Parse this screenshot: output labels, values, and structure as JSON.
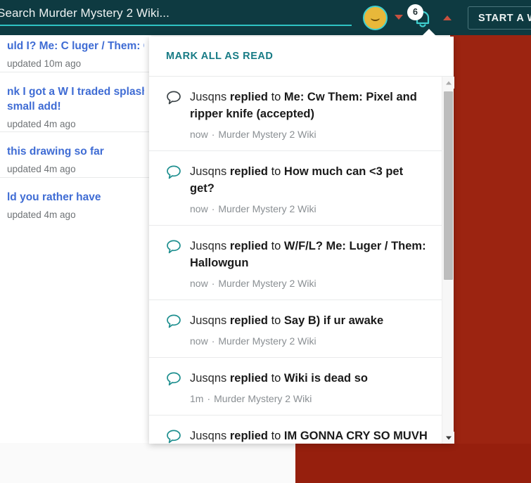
{
  "header": {
    "search_placeholder": "Search Murder Mystery 2 Wiki...",
    "search_value": "",
    "avatar_icon": "user-avatar-face",
    "avatar_face_glyph": "⌣",
    "user_caret_icon": "caret-down-icon",
    "bell_icon": "notification-bell-icon",
    "bell_badge_count": "6",
    "bell_caret_icon": "caret-up-icon",
    "start_wiki_label": "START A W",
    "colors": {
      "header_bg": "#0e3a41",
      "accent_teal": "#2ec3c3",
      "badge_red": "#c7513f",
      "content_red": "#9c2411"
    }
  },
  "sidebar": {
    "posts": [
      {
        "title": "uld I? Me: C luger / Them: C las",
        "meta": "updated 10m ago"
      },
      {
        "title": "nk I got a W I traded splash gu",
        "title2": "small add!",
        "meta": "updated 4m ago"
      },
      {
        "title": "this drawing so far",
        "meta": "updated 4m ago"
      },
      {
        "title": "ld you rather have",
        "meta": "updated 4m ago"
      }
    ]
  },
  "notifications_dropdown": {
    "mark_all_label": "MARK ALL AS READ",
    "scrollbar": {
      "up_icon": "scroll-up-arrow-icon",
      "down_icon": "scroll-down-arrow-icon"
    },
    "items": [
      {
        "icon": "comment-bubble-icon",
        "read": true,
        "actor": "Jusqns",
        "verb": "replied",
        "prep": "to",
        "subject": "Me: Cw Them: Pixel and ripper knife (accepted)",
        "time": "now",
        "wiki": "Murder Mystery 2 Wiki"
      },
      {
        "icon": "comment-bubble-icon",
        "read": false,
        "actor": "Jusqns",
        "verb": "replied",
        "prep": "to",
        "subject": "How much can <3 pet get?",
        "time": "now",
        "wiki": "Murder Mystery 2 Wiki"
      },
      {
        "icon": "comment-bubble-icon",
        "read": false,
        "actor": "Jusqns",
        "verb": "replied",
        "prep": "to",
        "subject": "W/F/L? Me: Luger / Them: Hallowgun",
        "time": "now",
        "wiki": "Murder Mystery 2 Wiki"
      },
      {
        "icon": "comment-bubble-icon",
        "read": false,
        "actor": "Jusqns",
        "verb": "replied",
        "prep": "to",
        "subject": "Say B) if ur awake",
        "time": "now",
        "wiki": "Murder Mystery 2 Wiki"
      },
      {
        "icon": "comment-bubble-icon",
        "read": false,
        "actor": "Jusqns",
        "verb": "replied",
        "prep": "to",
        "subject": "Wiki is dead so",
        "time": "1m",
        "wiki": "Murder Mystery 2 Wiki"
      },
      {
        "icon": "comment-bubble-icon",
        "read": false,
        "actor": "Jusqns",
        "verb": "replied",
        "prep": "to",
        "subject": "IM GONNA CRY SO MUVH",
        "time": "",
        "wiki": ""
      }
    ]
  }
}
